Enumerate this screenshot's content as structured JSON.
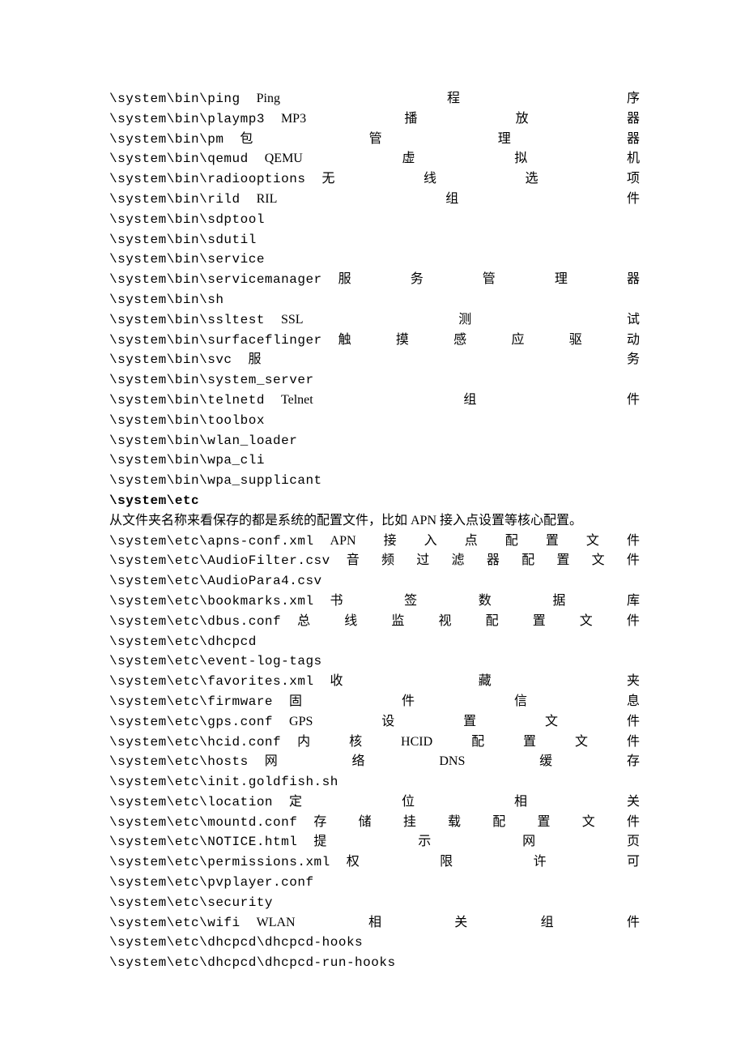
{
  "section1": {
    "rows": [
      {
        "path": "\\system\\bin\\ping",
        "desc": "Ping程序"
      },
      {
        "path": "\\system\\bin\\playmp3",
        "desc": "MP3播放器"
      },
      {
        "path": "\\system\\bin\\pm",
        "desc": "包管理器"
      },
      {
        "path": "\\system\\bin\\qemud",
        "desc": "QEMU虚拟机"
      },
      {
        "path": "\\system\\bin\\radiooptions",
        "desc": "无线选项"
      },
      {
        "path": "\\system\\bin\\rild",
        "desc": "RIL组件"
      },
      {
        "path": "\\system\\bin\\sdptool",
        "desc": ""
      },
      {
        "path": "\\system\\bin\\sdutil",
        "desc": ""
      },
      {
        "path": "\\system\\bin\\service",
        "desc": ""
      },
      {
        "path": "\\system\\bin\\servicemanager",
        "desc": "服务管理器"
      },
      {
        "path": "\\system\\bin\\sh",
        "desc": ""
      },
      {
        "path": "\\system\\bin\\ssltest",
        "desc": "SSL测试"
      },
      {
        "path": "\\system\\bin\\surfaceflinger",
        "desc": "触摸感应驱动"
      },
      {
        "path": "\\system\\bin\\svc",
        "desc": "服务"
      },
      {
        "path": "\\system\\bin\\system_server",
        "desc": ""
      },
      {
        "path": "\\system\\bin\\telnetd",
        "desc": "Telnet组件"
      },
      {
        "path": "\\system\\bin\\toolbox",
        "desc": ""
      },
      {
        "path": "\\system\\bin\\wlan_loader",
        "desc": ""
      },
      {
        "path": "\\system\\bin\\wpa_cli",
        "desc": ""
      },
      {
        "path": "\\system\\bin\\wpa_supplicant",
        "desc": ""
      }
    ]
  },
  "section2": {
    "header": "\\system\\etc",
    "intro": "从文件夹名称来看保存的都是系统的配置文件，比如 APN 接入点设置等核心配置。",
    "rows": [
      {
        "path": "\\system\\etc\\apns-conf.xml",
        "desc": "APN接入点配置文件"
      },
      {
        "path": "\\system\\etc\\AudioFilter.csv",
        "desc": "音频过滤器配置文件"
      },
      {
        "path": "\\system\\etc\\AudioPara4.csv",
        "desc": ""
      },
      {
        "path": "\\system\\etc\\bookmarks.xml",
        "desc": "书签数据库"
      },
      {
        "path": "\\system\\etc\\dbus.conf",
        "desc": "总线监视配置文件"
      },
      {
        "path": "\\system\\etc\\dhcpcd",
        "desc": ""
      },
      {
        "path": "\\system\\etc\\event-log-tags",
        "desc": ""
      },
      {
        "path": "\\system\\etc\\favorites.xml",
        "desc": "收藏夹"
      },
      {
        "path": "\\system\\etc\\firmware",
        "desc": "固件信息"
      },
      {
        "path": "\\system\\etc\\gps.conf",
        "desc": "GPS设置文件"
      },
      {
        "path": "\\system\\etc\\hcid.conf",
        "desc": "内核HCID配置文件"
      },
      {
        "path": "\\system\\etc\\hosts",
        "desc": "网络DNS缓存"
      },
      {
        "path": "\\system\\etc\\init.goldfish.sh",
        "desc": ""
      },
      {
        "path": "\\system\\etc\\location",
        "desc": "定位相关"
      },
      {
        "path": "\\system\\etc\\mountd.conf",
        "desc": "存储挂载配置文件"
      },
      {
        "path": "\\system\\etc\\NOTICE.html",
        "desc": "提示网页"
      },
      {
        "path": "\\system\\etc\\permissions.xml",
        "desc": "权限许可"
      },
      {
        "path": "\\system\\etc\\pvplayer.conf",
        "desc": ""
      },
      {
        "path": "\\system\\etc\\security",
        "desc": ""
      },
      {
        "path": "\\system\\etc\\wifi",
        "desc": "WLAN相关组件"
      },
      {
        "path": "\\system\\etc\\dhcpcd\\dhcpcd-hooks",
        "desc": ""
      },
      {
        "path": "\\system\\etc\\dhcpcd\\dhcpcd-run-hooks",
        "desc": ""
      }
    ]
  }
}
